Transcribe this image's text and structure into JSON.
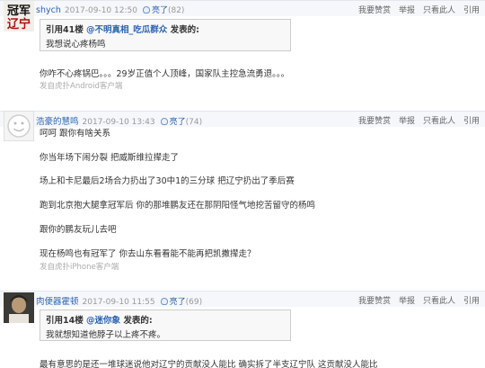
{
  "posts": [
    {
      "user": "shych",
      "time": "2017-09-10 12:50",
      "light_label": "亮了",
      "light_count": "(82)",
      "actions": [
        "我要赞赏",
        "举报",
        "只看此人",
        "引用"
      ],
      "quote": {
        "prefix": "引用41楼",
        "name": "@不明真相_吃瓜群众",
        "suffix": "发表的:",
        "body": "我想说心疼杨鸣"
      },
      "lines": [
        "你咋不心疼锅巴。。。29岁正值个人顶峰，国家队主控急流勇退。。。"
      ],
      "source": "发自虎扑Android客户端"
    },
    {
      "user": "浩豪的慧鸣",
      "time": "2017-09-10 13:43",
      "light_label": "亮了",
      "light_count": "(74)",
      "actions": [
        "我要赞赏",
        "举报",
        "只看此人",
        "引用"
      ],
      "lines": [
        "呵呵 跟你有啥关系",
        "你当年场下闹分裂 把威斯维拉撵走了",
        "场上和卡尼最后2场合力扔出了30中1的三分球 把辽宁扔出了季后赛",
        "跑到北京抱大腿拿冠军后 你的那堆鹏友还在那阴阳怪气地挖苦留守的杨鸣",
        "跟你的鹏友玩儿去吧",
        "现在杨鸣也有冠军了 你去山东看看能不能再把凯撒撵走？"
      ],
      "source": "发自虎扑iPhone客户端"
    },
    {
      "user": "肉便器霍顿",
      "time": "2017-09-10 11:55",
      "light_label": "亮了",
      "light_count": "(69)",
      "actions": [
        "我要赞赏",
        "举报",
        "只看此人",
        "引用"
      ],
      "quote": {
        "prefix": "引用14楼",
        "name": "@迷你象",
        "suffix": "发表的:",
        "body": "我就想知道他脖子以上疼不疼。"
      },
      "lines": [
        "最有意思的是还一堆球迷说他对辽宁的贡献没人能比 确实拆了半支辽宁队 这贡献没人能比"
      ]
    }
  ]
}
